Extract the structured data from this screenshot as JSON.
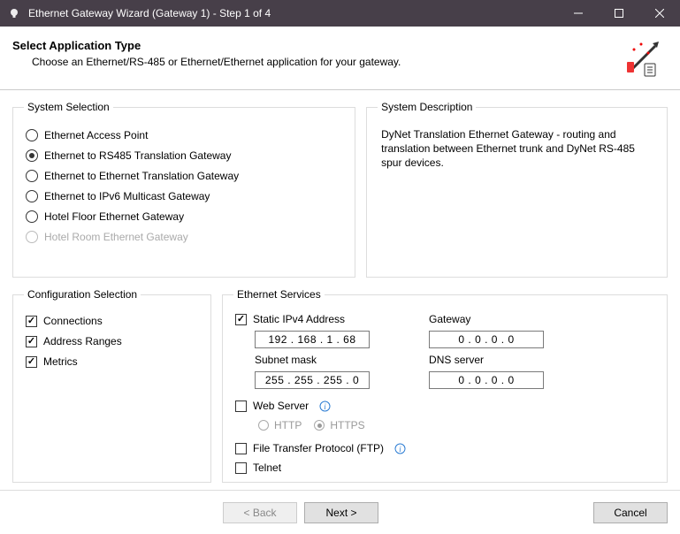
{
  "window": {
    "title": "Ethernet Gateway Wizard (Gateway 1) - Step 1 of 4"
  },
  "header": {
    "title": "Select Application Type",
    "subtitle": "Choose an Ethernet/RS-485 or Ethernet/Ethernet application for your gateway."
  },
  "systemSelection": {
    "legend": "System Selection",
    "options": [
      {
        "label": "Ethernet Access Point"
      },
      {
        "label": "Ethernet to RS485 Translation Gateway"
      },
      {
        "label": "Ethernet to Ethernet Translation Gateway"
      },
      {
        "label": "Ethernet to IPv6 Multicast Gateway"
      },
      {
        "label": "Hotel Floor Ethernet Gateway"
      },
      {
        "label": "Hotel Room Ethernet Gateway"
      }
    ]
  },
  "systemDescription": {
    "legend": "System Description",
    "text": "DyNet Translation Ethernet Gateway - routing and translation between Ethernet trunk and DyNet RS-485 spur devices."
  },
  "configSelection": {
    "legend": "Configuration Selection",
    "options": [
      {
        "label": "Connections"
      },
      {
        "label": "Address Ranges"
      },
      {
        "label": "Metrics"
      }
    ]
  },
  "ethernetServices": {
    "legend": "Ethernet Services",
    "staticIpv4": {
      "label": "Static IPv4 Address",
      "value": "192 . 168  .   1   .   68"
    },
    "subnetMask": {
      "label": "Subnet mask",
      "value": "255 . 255  . 255  .    0"
    },
    "gateway": {
      "label": "Gateway",
      "value": "0   .   0   .   0   .    0"
    },
    "dnsServer": {
      "label": "DNS server",
      "value": "0   .   0   .   0   .    0"
    },
    "webServer": {
      "label": "Web Server",
      "http": "HTTP",
      "https": "HTTPS"
    },
    "ftp": {
      "label": "File Transfer Protocol (FTP)"
    },
    "telnet": {
      "label": "Telnet"
    }
  },
  "buttons": {
    "back": "<  Back",
    "next": "Next  >",
    "cancel": "Cancel"
  }
}
